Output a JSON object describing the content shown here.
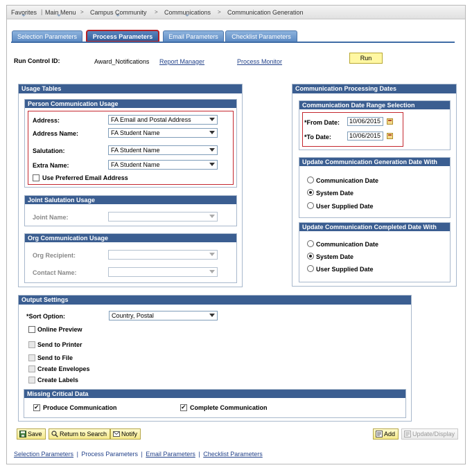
{
  "menu": {
    "favorites": "Favorites",
    "main_menu": "Main Menu",
    "campus_community": "Campus Community",
    "communications": "Communications",
    "communication_generation": "Communication Generation"
  },
  "tabs": [
    {
      "label": "Selection Parameters"
    },
    {
      "label": "Process Parameters"
    },
    {
      "label": "Email Parameters"
    },
    {
      "label": "Checklist Parameters"
    }
  ],
  "run_control": {
    "label": "Run Control ID:",
    "value": "Award_Notifications",
    "report_manager": "Report Manager",
    "process_monitor": "Process Monitor",
    "run_button": "Run"
  },
  "usage_tables": {
    "title": "Usage Tables",
    "person": {
      "title": "Person Communication Usage",
      "address_label": "Address:",
      "address_value": "FA Email and Postal Address",
      "address_name_label": "Address Name:",
      "address_name_value": "FA Student Name",
      "salutation_label": "Salutation:",
      "salutation_value": "FA Student Name",
      "extra_name_label": "Extra Name:",
      "extra_name_value": "FA Student Name",
      "preferred_email_label": "Use Preferred Email Address"
    },
    "joint": {
      "title": "Joint Salutation Usage",
      "joint_name_label": "Joint Name:"
    },
    "org": {
      "title": "Org Communication Usage",
      "org_recipient_label": "Org Recipient:",
      "contact_name_label": "Contact Name:"
    }
  },
  "processing_dates": {
    "title": "Communication Processing Dates",
    "range": {
      "title": "Communication Date Range Selection",
      "from_label": "*From Date:",
      "from_value": "10/06/2015",
      "to_label": "*To Date:",
      "to_value": "10/06/2015"
    },
    "generation": {
      "title": "Update Communication Generation Date With",
      "options": [
        "Communication Date",
        "System Date",
        "User Supplied Date"
      ],
      "selected": "System Date"
    },
    "completed": {
      "title": "Update Communication Completed Date With",
      "options": [
        "Communication Date",
        "System Date",
        "User Supplied Date"
      ],
      "selected": "System Date"
    }
  },
  "output": {
    "title": "Output Settings",
    "sort_label": "*Sort Option:",
    "sort_value": "Country, Postal",
    "online_preview": "Online Preview",
    "send_to_printer": "Send to Printer",
    "send_to_file": "Send to File",
    "create_envelopes": "Create Envelopes",
    "create_labels": "Create Labels",
    "missing": {
      "title": "Missing Critical Data",
      "produce": "Produce Communication",
      "complete": "Complete Communication"
    }
  },
  "buttons": {
    "save": "Save",
    "return_to_search": "Return to Search",
    "notify": "Notify",
    "add": "Add",
    "update_display": "Update/Display"
  },
  "footer": {
    "selection": "Selection Parameters",
    "process": "Process Parameters",
    "email": "Email Parameters",
    "checklist": "Checklist Parameters",
    "separator": "|"
  },
  "colors": {
    "header_blue": "#3b5e91",
    "tab_blue": "#5d8bc4",
    "highlight_red": "#c4262e",
    "run_yellow": "#fff7a3"
  }
}
